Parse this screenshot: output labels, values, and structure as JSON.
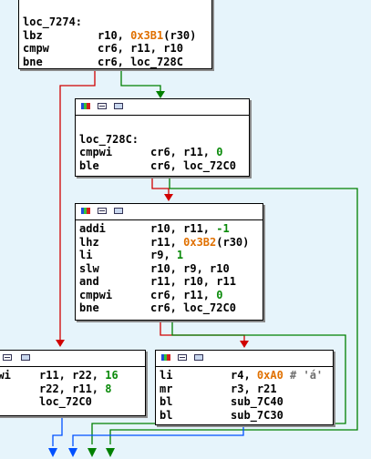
{
  "colors": {
    "background": "#e6f4fb",
    "edge_true": "#008000",
    "edge_false": "#d00000",
    "edge_uncond": "#0050ff",
    "immediate": "#e07000"
  },
  "header_icons": [
    "graph-icon",
    "list-icon",
    "view-icon"
  ],
  "nodes": {
    "n7274": {
      "lines": [
        {
          "mn": "loc_7274:",
          "op": ""
        },
        {
          "mn": "lbz",
          "op": "r10, ",
          "imm": "0x3B1",
          "rest": "(r30)"
        },
        {
          "mn": "cmpw",
          "op": "cr6, r11, r10"
        },
        {
          "mn": "bne",
          "op": "cr6, loc_728C"
        }
      ]
    },
    "n728C": {
      "lines": [
        {
          "mn": "",
          "op": ""
        },
        {
          "mn": "loc_728C:",
          "op": ""
        },
        {
          "mn": "cmpwi",
          "op": "cr6, r11, ",
          "grn": "0"
        },
        {
          "mn": "ble",
          "op": "cr6, loc_72C0"
        }
      ]
    },
    "nmid": {
      "lines": [
        {
          "mn": "addi",
          "op": "r10, r11, ",
          "grn": "-1"
        },
        {
          "mn": "lhz",
          "op": "r11, ",
          "imm": "0x3B2",
          "rest": "(r30)"
        },
        {
          "mn": "li",
          "op": "r9, ",
          "grn": "1"
        },
        {
          "mn": "slw",
          "op": "r10, r9, r10"
        },
        {
          "mn": "and",
          "op": "r11, r10, r11"
        },
        {
          "mn": "cmpwi",
          "op": "cr6, r11, ",
          "grn": "0"
        },
        {
          "mn": "bne",
          "op": "cr6, loc_72C0"
        }
      ]
    },
    "nleft": {
      "lines": [
        {
          "mn": "rlwi",
          "op": "r11, r22, ",
          "grn": "16"
        },
        {
          "mn": "i",
          "op": "r22, r11, ",
          "grn": "8"
        },
        {
          "mn": "",
          "op": "loc_72C0"
        }
      ]
    },
    "nright": {
      "lines": [
        {
          "mn": "li",
          "op": "r4, ",
          "imm": "0xA0",
          "cmt": " # 'á'"
        },
        {
          "mn": "mr",
          "op": "r3, r21"
        },
        {
          "mn": "bl",
          "op": "sub_7C40"
        },
        {
          "mn": "bl",
          "op": "sub_7C30"
        }
      ]
    }
  }
}
